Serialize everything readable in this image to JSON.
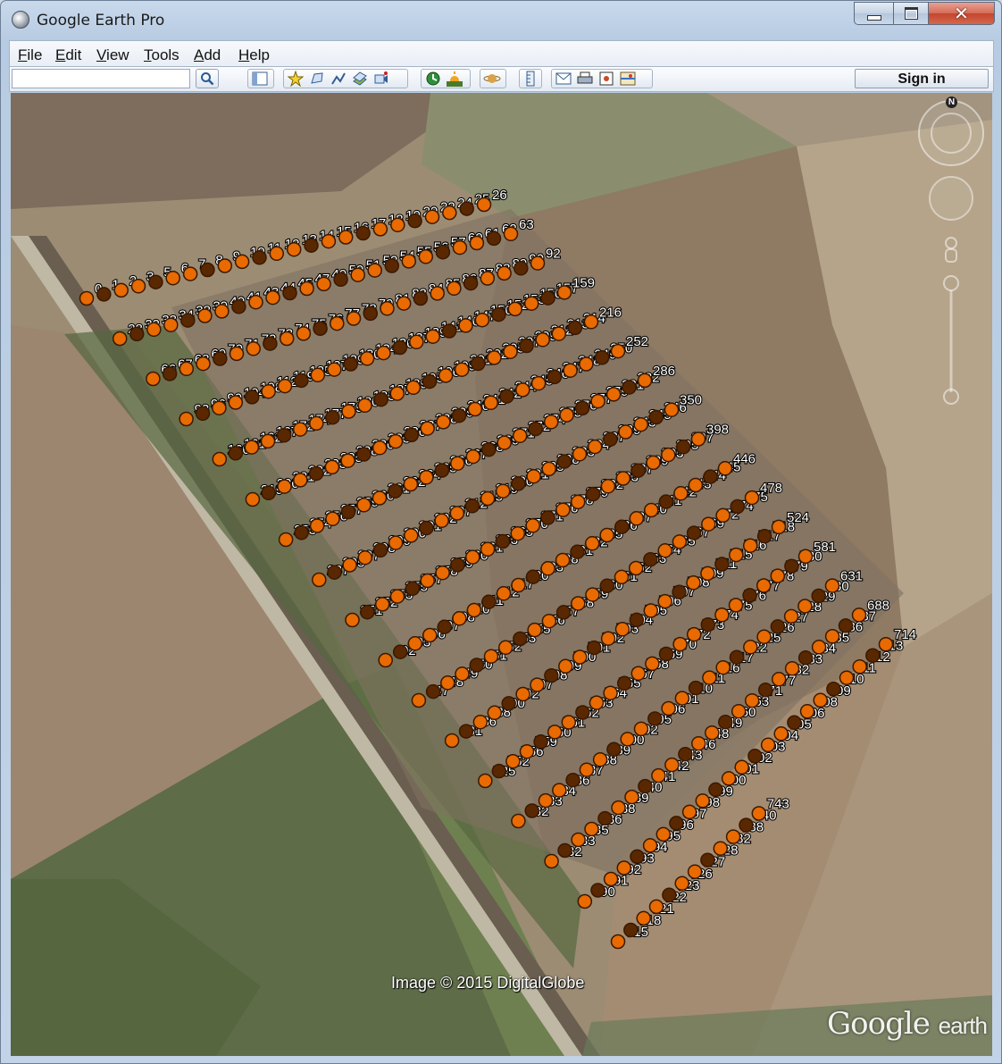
{
  "window": {
    "title": "Google Earth Pro"
  },
  "menu": [
    {
      "label": "File",
      "key": "F"
    },
    {
      "label": "Edit",
      "key": "E"
    },
    {
      "label": "View",
      "key": "V"
    },
    {
      "label": "Tools",
      "key": "T"
    },
    {
      "label": "Add",
      "key": "A"
    },
    {
      "label": "Help",
      "key": "H"
    }
  ],
  "toolbar": {
    "search_value": "",
    "sign_in_label": "Sign in",
    "icons": [
      "search-icon",
      "sidebar-toggle-icon",
      "add-placemark-icon",
      "add-polygon-icon",
      "add-path-icon",
      "add-image-overlay-icon",
      "record-tour-icon",
      "historical-imagery-icon",
      "sunlight-icon",
      "switch-planet-icon",
      "ruler-icon",
      "email-icon",
      "print-icon",
      "save-image-icon",
      "view-in-maps-icon"
    ]
  },
  "map": {
    "imagery_credit": "Image © 2015 DigitalGlobe",
    "logo": {
      "main": "Google",
      "sub": "earth"
    },
    "compass_north": "N",
    "colors": {
      "placemark_fill": "#e86a00",
      "placemark_dark": "#5a2800",
      "label": "#ffffff"
    },
    "placemarks": [
      {
        "id": "0"
      },
      {
        "id": "1"
      },
      {
        "id": "2"
      },
      {
        "id": "3"
      },
      {
        "id": "5"
      },
      {
        "id": "6"
      },
      {
        "id": "7"
      },
      {
        "id": "8"
      },
      {
        "id": "9"
      },
      {
        "id": "10"
      },
      {
        "id": "11"
      },
      {
        "id": "12"
      },
      {
        "id": "13"
      },
      {
        "id": "14"
      },
      {
        "id": "15"
      },
      {
        "id": "16"
      },
      {
        "id": "17"
      },
      {
        "id": "18"
      },
      {
        "id": "19"
      },
      {
        "id": "20"
      },
      {
        "id": "22"
      },
      {
        "id": "24"
      },
      {
        "id": "25"
      },
      {
        "id": "26"
      },
      {
        "id": "28"
      },
      {
        "id": "32"
      },
      {
        "id": "33"
      },
      {
        "id": "34"
      },
      {
        "id": "38"
      },
      {
        "id": "39"
      },
      {
        "id": "40"
      },
      {
        "id": "41"
      },
      {
        "id": "43"
      },
      {
        "id": "44"
      },
      {
        "id": "45"
      },
      {
        "id": "47"
      },
      {
        "id": "49"
      },
      {
        "id": "50"
      },
      {
        "id": "51"
      },
      {
        "id": "52"
      },
      {
        "id": "54"
      },
      {
        "id": "55"
      },
      {
        "id": "56"
      },
      {
        "id": "57"
      },
      {
        "id": "60"
      },
      {
        "id": "61"
      },
      {
        "id": "62"
      },
      {
        "id": "63"
      },
      {
        "id": "66"
      },
      {
        "id": "67"
      },
      {
        "id": "68"
      },
      {
        "id": "69"
      },
      {
        "id": "70"
      },
      {
        "id": "71"
      },
      {
        "id": "72"
      },
      {
        "id": "73"
      },
      {
        "id": "74"
      },
      {
        "id": "75"
      },
      {
        "id": "76"
      },
      {
        "id": "77"
      },
      {
        "id": "78"
      },
      {
        "id": "79"
      },
      {
        "id": "81"
      },
      {
        "id": "83"
      },
      {
        "id": "84"
      },
      {
        "id": "85"
      },
      {
        "id": "86"
      },
      {
        "id": "87"
      },
      {
        "id": "88"
      },
      {
        "id": "89"
      },
      {
        "id": "90"
      },
      {
        "id": "92"
      },
      {
        "id": "93"
      },
      {
        "id": "96"
      },
      {
        "id": "99"
      },
      {
        "id": "104"
      },
      {
        "id": "108"
      },
      {
        "id": "112"
      },
      {
        "id": "119"
      },
      {
        "id": "125"
      },
      {
        "id": "127"
      },
      {
        "id": "129"
      },
      {
        "id": "130"
      },
      {
        "id": "134"
      },
      {
        "id": "136"
      },
      {
        "id": "137"
      },
      {
        "id": "139"
      },
      {
        "id": "141"
      },
      {
        "id": "146"
      },
      {
        "id": "147"
      },
      {
        "id": "150"
      },
      {
        "id": "152"
      },
      {
        "id": "153"
      },
      {
        "id": "156"
      },
      {
        "id": "157"
      },
      {
        "id": "159"
      },
      {
        "id": "160"
      },
      {
        "id": "161"
      },
      {
        "id": "162"
      },
      {
        "id": "167"
      },
      {
        "id": "172"
      },
      {
        "id": "174"
      },
      {
        "id": "177"
      },
      {
        "id": "179"
      },
      {
        "id": "180"
      },
      {
        "id": "183"
      },
      {
        "id": "187"
      },
      {
        "id": "189"
      },
      {
        "id": "195"
      },
      {
        "id": "196"
      },
      {
        "id": "199"
      },
      {
        "id": "201"
      },
      {
        "id": "202"
      },
      {
        "id": "205"
      },
      {
        "id": "207"
      },
      {
        "id": "209"
      },
      {
        "id": "212"
      },
      {
        "id": "213"
      },
      {
        "id": "214"
      },
      {
        "id": "216"
      },
      {
        "id": "219"
      },
      {
        "id": "220"
      },
      {
        "id": "221"
      },
      {
        "id": "222"
      },
      {
        "id": "223"
      },
      {
        "id": "225"
      },
      {
        "id": "228"
      },
      {
        "id": "230"
      },
      {
        "id": "233"
      },
      {
        "id": "236"
      },
      {
        "id": "237"
      },
      {
        "id": "238"
      },
      {
        "id": "239"
      },
      {
        "id": "240"
      },
      {
        "id": "241"
      },
      {
        "id": "242"
      },
      {
        "id": "244"
      },
      {
        "id": "245"
      },
      {
        "id": "246"
      },
      {
        "id": "247"
      },
      {
        "id": "248"
      },
      {
        "id": "249"
      },
      {
        "id": "250"
      },
      {
        "id": "252"
      },
      {
        "id": "253"
      },
      {
        "id": "254"
      },
      {
        "id": "256"
      },
      {
        "id": "257"
      },
      {
        "id": "259"
      },
      {
        "id": "260"
      },
      {
        "id": "261"
      },
      {
        "id": "262"
      },
      {
        "id": "264"
      },
      {
        "id": "265"
      },
      {
        "id": "266"
      },
      {
        "id": "267"
      },
      {
        "id": "268"
      },
      {
        "id": "269"
      },
      {
        "id": "271"
      },
      {
        "id": "272"
      },
      {
        "id": "274"
      },
      {
        "id": "275"
      },
      {
        "id": "276"
      },
      {
        "id": "277"
      },
      {
        "id": "279"
      },
      {
        "id": "281"
      },
      {
        "id": "282"
      },
      {
        "id": "286"
      },
      {
        "id": "287"
      },
      {
        "id": "295"
      },
      {
        "id": "297"
      },
      {
        "id": "298"
      },
      {
        "id": "299"
      },
      {
        "id": "300"
      },
      {
        "id": "301"
      },
      {
        "id": "302"
      },
      {
        "id": "307"
      },
      {
        "id": "312"
      },
      {
        "id": "315"
      },
      {
        "id": "319"
      },
      {
        "id": "320"
      },
      {
        "id": "321"
      },
      {
        "id": "325"
      },
      {
        "id": "328"
      },
      {
        "id": "333"
      },
      {
        "id": "334"
      },
      {
        "id": "337"
      },
      {
        "id": "339"
      },
      {
        "id": "343"
      },
      {
        "id": "345"
      },
      {
        "id": "346"
      },
      {
        "id": "350"
      },
      {
        "id": "351"
      },
      {
        "id": "352"
      },
      {
        "id": "353"
      },
      {
        "id": "355"
      },
      {
        "id": "357"
      },
      {
        "id": "358"
      },
      {
        "id": "359"
      },
      {
        "id": "360"
      },
      {
        "id": "361"
      },
      {
        "id": "363"
      },
      {
        "id": "365"
      },
      {
        "id": "370"
      },
      {
        "id": "371"
      },
      {
        "id": "376"
      },
      {
        "id": "378"
      },
      {
        "id": "379"
      },
      {
        "id": "382"
      },
      {
        "id": "383"
      },
      {
        "id": "387"
      },
      {
        "id": "389"
      },
      {
        "id": "393"
      },
      {
        "id": "395"
      },
      {
        "id": "397"
      },
      {
        "id": "398"
      },
      {
        "id": "402"
      },
      {
        "id": "403"
      },
      {
        "id": "406"
      },
      {
        "id": "407"
      },
      {
        "id": "408"
      },
      {
        "id": "410"
      },
      {
        "id": "411"
      },
      {
        "id": "412"
      },
      {
        "id": "417"
      },
      {
        "id": "420"
      },
      {
        "id": "423"
      },
      {
        "id": "428"
      },
      {
        "id": "431"
      },
      {
        "id": "432"
      },
      {
        "id": "435"
      },
      {
        "id": "436"
      },
      {
        "id": "437"
      },
      {
        "id": "440"
      },
      {
        "id": "441"
      },
      {
        "id": "442"
      },
      {
        "id": "443"
      },
      {
        "id": "444"
      },
      {
        "id": "445"
      },
      {
        "id": "446"
      },
      {
        "id": "447"
      },
      {
        "id": "448"
      },
      {
        "id": "449"
      },
      {
        "id": "450"
      },
      {
        "id": "451"
      },
      {
        "id": "452"
      },
      {
        "id": "453"
      },
      {
        "id": "455"
      },
      {
        "id": "456"
      },
      {
        "id": "457"
      },
      {
        "id": "458"
      },
      {
        "id": "459"
      },
      {
        "id": "460"
      },
      {
        "id": "461"
      },
      {
        "id": "462"
      },
      {
        "id": "463"
      },
      {
        "id": "464"
      },
      {
        "id": "465"
      },
      {
        "id": "467"
      },
      {
        "id": "469"
      },
      {
        "id": "472"
      },
      {
        "id": "474"
      },
      {
        "id": "475"
      },
      {
        "id": "478"
      },
      {
        "id": "481"
      },
      {
        "id": "486"
      },
      {
        "id": "488"
      },
      {
        "id": "490"
      },
      {
        "id": "492"
      },
      {
        "id": "497"
      },
      {
        "id": "498"
      },
      {
        "id": "499"
      },
      {
        "id": "500"
      },
      {
        "id": "501"
      },
      {
        "id": "502"
      },
      {
        "id": "503"
      },
      {
        "id": "504"
      },
      {
        "id": "505"
      },
      {
        "id": "506"
      },
      {
        "id": "507"
      },
      {
        "id": "508"
      },
      {
        "id": "509"
      },
      {
        "id": "511"
      },
      {
        "id": "515"
      },
      {
        "id": "516"
      },
      {
        "id": "517"
      },
      {
        "id": "518"
      },
      {
        "id": "524"
      },
      {
        "id": "525"
      },
      {
        "id": "552"
      },
      {
        "id": "556"
      },
      {
        "id": "559"
      },
      {
        "id": "560"
      },
      {
        "id": "561"
      },
      {
        "id": "562"
      },
      {
        "id": "563"
      },
      {
        "id": "564"
      },
      {
        "id": "565"
      },
      {
        "id": "567"
      },
      {
        "id": "568"
      },
      {
        "id": "569"
      },
      {
        "id": "570"
      },
      {
        "id": "572"
      },
      {
        "id": "573"
      },
      {
        "id": "574"
      },
      {
        "id": "575"
      },
      {
        "id": "576"
      },
      {
        "id": "577"
      },
      {
        "id": "578"
      },
      {
        "id": "579"
      },
      {
        "id": "580"
      },
      {
        "id": "581"
      },
      {
        "id": "582"
      },
      {
        "id": "583"
      },
      {
        "id": "584"
      },
      {
        "id": "586"
      },
      {
        "id": "587"
      },
      {
        "id": "588"
      },
      {
        "id": "589"
      },
      {
        "id": "590"
      },
      {
        "id": "592"
      },
      {
        "id": "595"
      },
      {
        "id": "596"
      },
      {
        "id": "601"
      },
      {
        "id": "610"
      },
      {
        "id": "611"
      },
      {
        "id": "616"
      },
      {
        "id": "617"
      },
      {
        "id": "622"
      },
      {
        "id": "625"
      },
      {
        "id": "626"
      },
      {
        "id": "627"
      },
      {
        "id": "628"
      },
      {
        "id": "629"
      },
      {
        "id": "630"
      },
      {
        "id": "631"
      },
      {
        "id": "632"
      },
      {
        "id": "633"
      },
      {
        "id": "635"
      },
      {
        "id": "636"
      },
      {
        "id": "638"
      },
      {
        "id": "639"
      },
      {
        "id": "640"
      },
      {
        "id": "641"
      },
      {
        "id": "642"
      },
      {
        "id": "643"
      },
      {
        "id": "646"
      },
      {
        "id": "648"
      },
      {
        "id": "649"
      },
      {
        "id": "660"
      },
      {
        "id": "663"
      },
      {
        "id": "671"
      },
      {
        "id": "677"
      },
      {
        "id": "682"
      },
      {
        "id": "683"
      },
      {
        "id": "684"
      },
      {
        "id": "685"
      },
      {
        "id": "686"
      },
      {
        "id": "687"
      },
      {
        "id": "688"
      },
      {
        "id": "690"
      },
      {
        "id": "691"
      },
      {
        "id": "692"
      },
      {
        "id": "693"
      },
      {
        "id": "694"
      },
      {
        "id": "695"
      },
      {
        "id": "696"
      },
      {
        "id": "697"
      },
      {
        "id": "698"
      },
      {
        "id": "699"
      },
      {
        "id": "700"
      },
      {
        "id": "701"
      },
      {
        "id": "702"
      },
      {
        "id": "703"
      },
      {
        "id": "704"
      },
      {
        "id": "705"
      },
      {
        "id": "706"
      },
      {
        "id": "708"
      },
      {
        "id": "709"
      },
      {
        "id": "710"
      },
      {
        "id": "711"
      },
      {
        "id": "712"
      },
      {
        "id": "713"
      },
      {
        "id": "714"
      },
      {
        "id": "715"
      },
      {
        "id": "718"
      },
      {
        "id": "721"
      },
      {
        "id": "722"
      },
      {
        "id": "723"
      },
      {
        "id": "726"
      },
      {
        "id": "727"
      },
      {
        "id": "728"
      },
      {
        "id": "732"
      },
      {
        "id": "738"
      },
      {
        "id": "740"
      },
      {
        "id": "743"
      }
    ]
  }
}
